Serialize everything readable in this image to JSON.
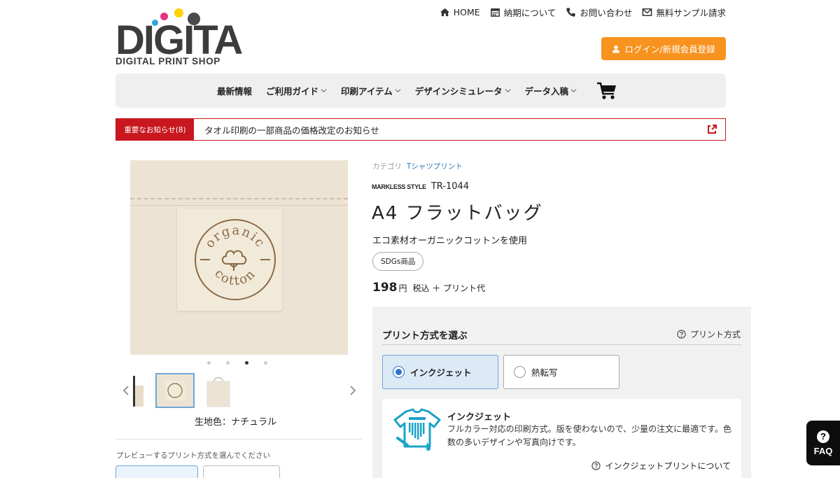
{
  "logo": {
    "word": "DIGITA",
    "sub": "DIGITAL PRINT SHOP",
    "dot_colors": [
      "#e7327e",
      "#2ea7e0",
      "#ffd200",
      "#4a4a4a"
    ]
  },
  "topnav": [
    {
      "label": "HOME",
      "icon": "home-icon"
    },
    {
      "label": "納期について",
      "icon": "calendar-icon"
    },
    {
      "label": "お問い合わせ",
      "icon": "phone-icon"
    },
    {
      "label": "無料サンプル請求",
      "icon": "mail-icon"
    }
  ],
  "login_button": "ログイン/新規会員登録",
  "mainnav": [
    {
      "label": "最新情報",
      "dropdown": false
    },
    {
      "label": "ご利用ガイド",
      "dropdown": true
    },
    {
      "label": "印刷アイテム",
      "dropdown": true
    },
    {
      "label": "デザインシミュレータ",
      "dropdown": true
    },
    {
      "label": "データ入稿",
      "dropdown": true
    }
  ],
  "notice": {
    "tag": "重要なお知らせ(8)",
    "message": "タオル印刷の一部商品の価格改定のお知らせ"
  },
  "gallery": {
    "image_count": 4,
    "active_index": 2,
    "stamp_top": "organic",
    "stamp_bottom": "cotton"
  },
  "color_label": "生地色：ナチュラル",
  "preview_label": "プレビューするプリント方式を選んでください",
  "product": {
    "category_label": "カテゴリ",
    "category_value": "Tシャツプリント",
    "brand": "MARKLESS STYLE",
    "code": "TR-1044",
    "title": "A4 フラットバッグ",
    "description": "エコ素材オーガニックコットンを使用",
    "badge": "SDGs商品",
    "price": "198",
    "price_unit": "円",
    "price_note": "税込 ＋ プリント代"
  },
  "print_panel": {
    "heading": "プリント方式を選ぶ",
    "help": "プリント方式",
    "options": [
      {
        "label": "インクジェット",
        "selected": true
      },
      {
        "label": "熱転写",
        "selected": false
      }
    ],
    "info_title": "インクジェット",
    "info_body": "フルカラー対応の印刷方式。版を使わないので、少量の注文に最適です。色数の多いデザインや写真向けです。",
    "info_link": "インクジェットプリントについて"
  },
  "faq": "FAQ",
  "colors": {
    "accent_orange": "#f7931e",
    "notice_red": "#c8171e",
    "link_blue": "#2a7ab8",
    "inkjet_teal": "#1aa3c8"
  }
}
